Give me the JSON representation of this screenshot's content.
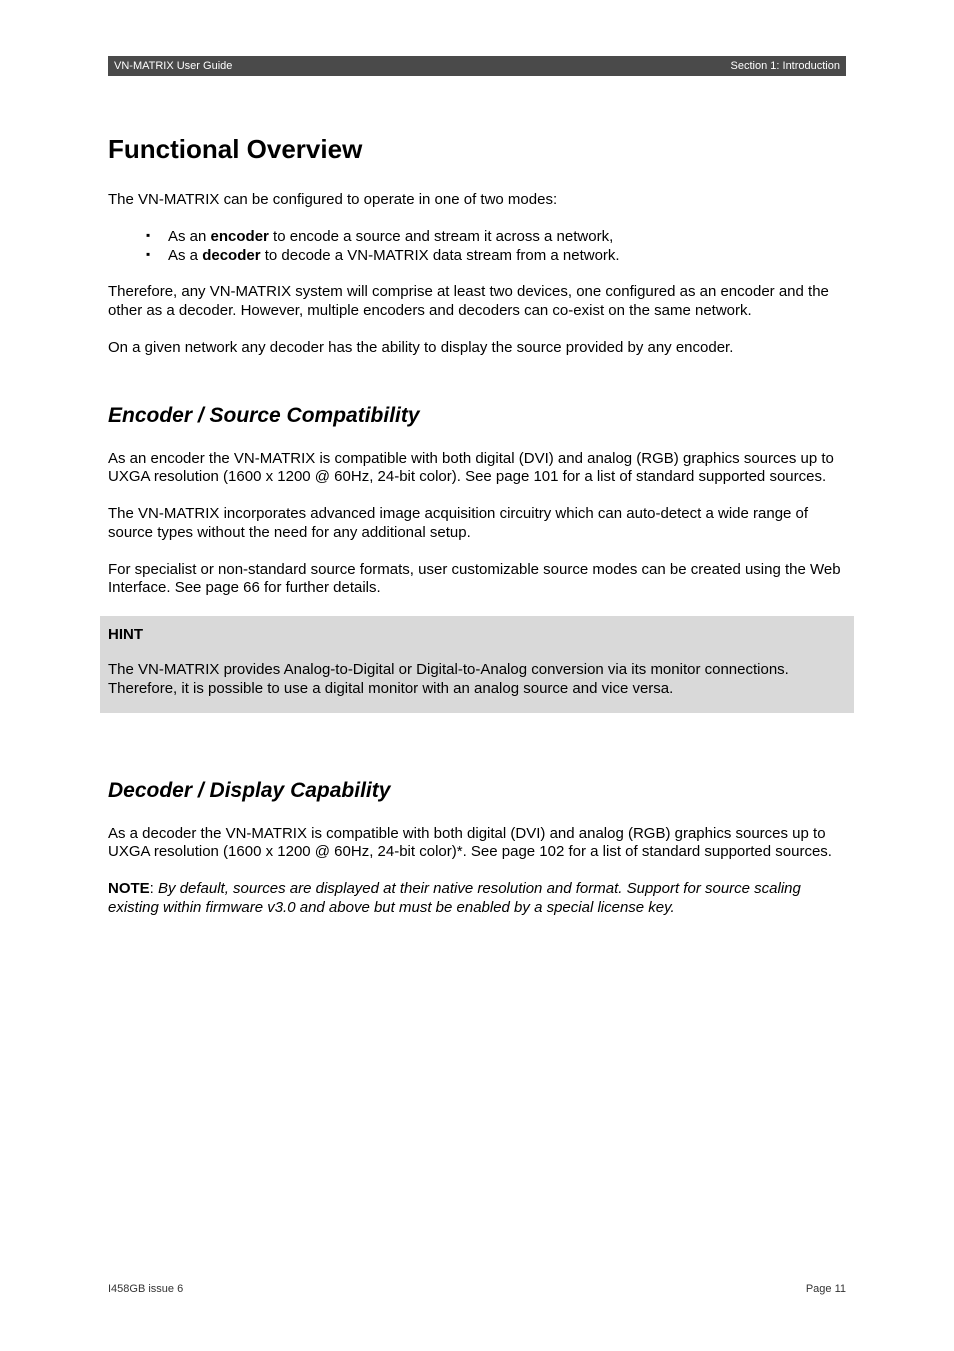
{
  "header": {
    "left": "VN-MATRIX User Guide",
    "right": "Section 1: Introduction"
  },
  "title": "Functional Overview",
  "intro": "The VN-MATRIX can be configured to operate in one of two modes:",
  "bullets": [
    {
      "prefix": "As an ",
      "bold": "encoder",
      "suffix": " to encode a source and stream it across a network,"
    },
    {
      "prefix": "As a ",
      "bold": "decoder",
      "suffix": " to decode a VN-MATRIX data stream from a network."
    }
  ],
  "para_after_bullets": "Therefore, any VN-MATRIX system will comprise at least two devices, one configured as an encoder and the other as a decoder. However, multiple encoders and decoders can co-exist on the same network.",
  "para_network": "On a given network any decoder has the ability to display the source provided by any encoder.",
  "section_encoder": {
    "heading": "Encoder / Source Compatibility",
    "p1": "As an encoder the VN-MATRIX is compatible with both digital (DVI) and analog (RGB) graphics sources up to UXGA resolution (1600 x 1200 @ 60Hz, 24-bit color). See page 101 for a list of standard supported sources.",
    "p2": "The VN-MATRIX incorporates advanced image acquisition circuitry which can auto-detect a wide range of source types without the need for any additional setup.",
    "p3": "For specialist or non-standard source formats, user customizable source modes can be created using the Web Interface. See page 66 for further details."
  },
  "hint": {
    "title": "HINT",
    "body": "The VN-MATRIX provides Analog-to-Digital or Digital-to-Analog conversion via its monitor connections. Therefore, it is possible to use a digital monitor with an analog source and vice versa."
  },
  "section_decoder": {
    "heading": "Decoder / Display Capability",
    "p1": "As a decoder the VN-MATRIX is compatible with both digital (DVI) and analog (RGB) graphics sources up to UXGA resolution (1600 x 1200 @ 60Hz, 24-bit color)*. See page 102 for a list of standard supported sources.",
    "note_label": "NOTE",
    "note_sep": ": ",
    "note_body": "By default, sources are displayed at their native resolution and format. Support for source scaling existing within firmware v3.0 and above but must be enabled by a special license key."
  },
  "footer": {
    "left": "I458GB issue 6",
    "right": "Page 11"
  }
}
